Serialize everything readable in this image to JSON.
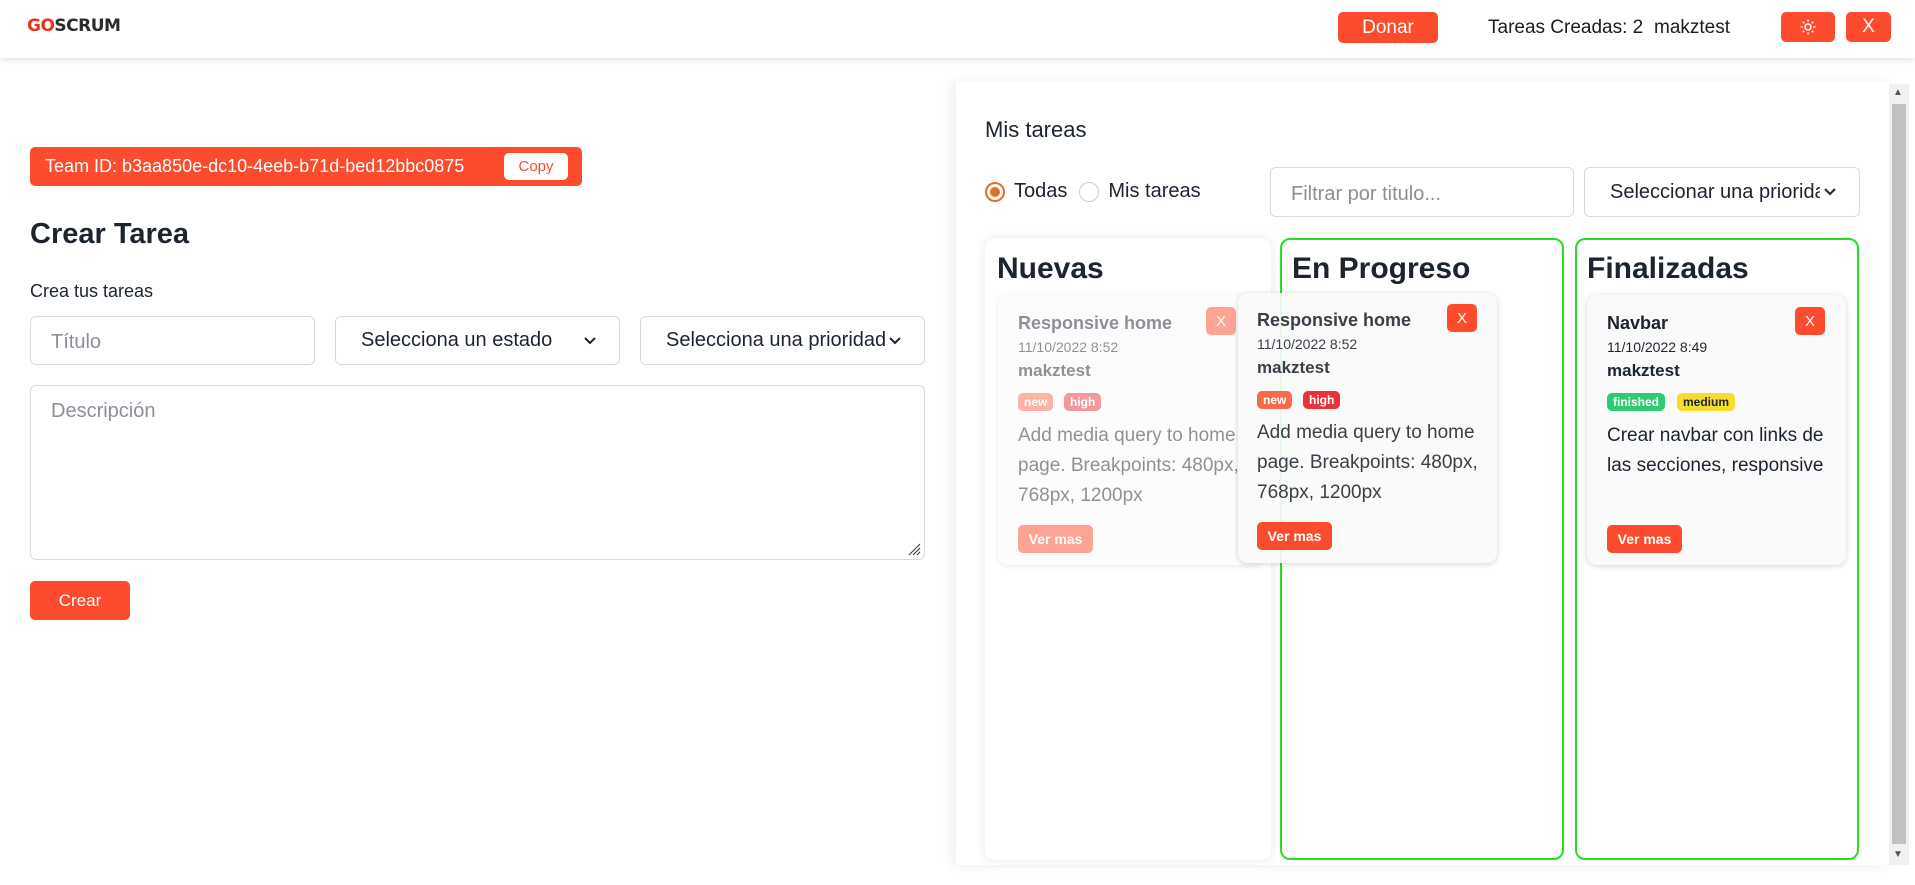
{
  "header": {
    "logo_go": "GO",
    "logo_scrum": "SCRUM",
    "donate_label": "Donar",
    "tasks_created": "Tareas Creadas: 2",
    "username": "makztest",
    "theme_icon": "sun-icon",
    "close_label": "X"
  },
  "team": {
    "text": "Team ID: b3aa850e-dc10-4eeb-b71d-bed12bbc0875",
    "copy_label": "Copy"
  },
  "form": {
    "title": "Crear Tarea",
    "subtitle": "Crea tus tareas",
    "title_placeholder": "Título",
    "status_select": "Selecciona un estado",
    "priority_select": "Selecciona una prioridad",
    "description_placeholder": "Descripción",
    "create_label": "Crear"
  },
  "tasks": {
    "title": "Mis tareas",
    "radio_all": "Todas",
    "radio_mine": "Mis tareas",
    "filter_placeholder": "Filtrar por titulo...",
    "priority_select": "Seleccionar una prioridad",
    "columns": {
      "new": "Nuevas",
      "in_progress": "En Progreso",
      "finished": "Finalizadas"
    },
    "cards": {
      "ghost": {
        "title": "Responsive home",
        "date": "11/10/2022 8:52",
        "user": "makztest",
        "status": "new",
        "priority": "high",
        "body": "Add media query to home page. Breakpoints: 480px, 768px, 1200px",
        "more": "Ver mas",
        "close": "X"
      },
      "dragging": {
        "title": "Responsive home",
        "date": "11/10/2022 8:52",
        "user": "makztest",
        "status": "new",
        "priority": "high",
        "body": "Add media query to home page. Breakpoints: 480px, 768px, 1200px",
        "more": "Ver mas",
        "close": "X"
      },
      "navbar": {
        "title": "Navbar",
        "date": "11/10/2022 8:49",
        "user": "makztest",
        "status": "finished",
        "priority": "medium",
        "body": "Crear navbar con links de las secciones, responsive",
        "more": "Ver mas",
        "close": "X"
      }
    }
  },
  "colors": {
    "accent": "#fc4b2d",
    "column_border": "#22e020",
    "tag_new": "#f86a4c",
    "tag_high": "#e8333a",
    "tag_finished": "#2ecc71",
    "tag_medium": "#f6dc2e"
  }
}
